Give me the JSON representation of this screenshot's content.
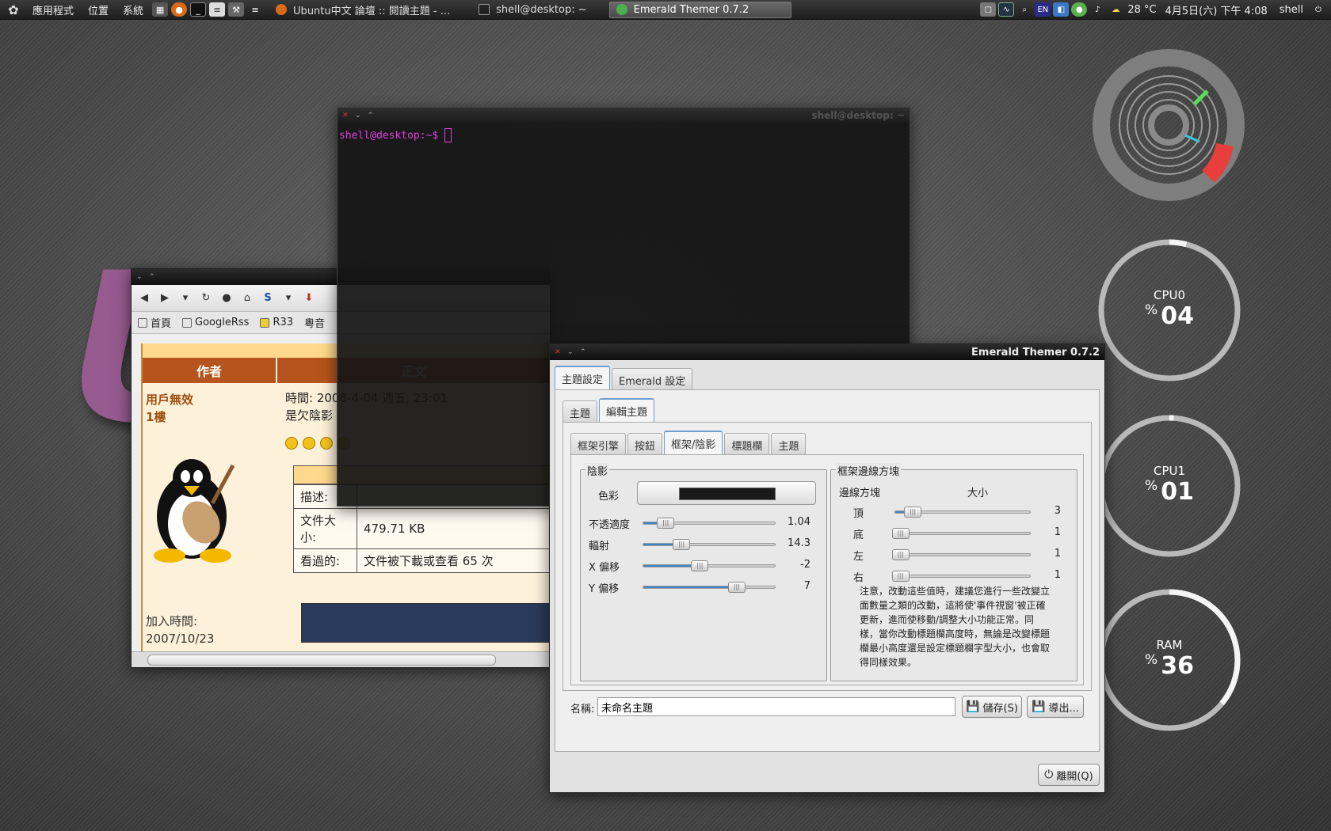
{
  "top_panel": {
    "menus": [
      "應用程式",
      "位置",
      "系統"
    ],
    "tasks": [
      {
        "label": "Ubuntu中文 論壇 :: 閱讀主題 - ...",
        "icon": "firefox-icon"
      },
      {
        "label": "shell@desktop: ~",
        "icon": "terminal-icon"
      },
      {
        "label": "Emerald Themer 0.7.2",
        "icon": "emerald-icon"
      }
    ],
    "input_method": "EN",
    "temperature": "28 °C",
    "datetime": "4月5日(六) 下午 4:08",
    "user": "shell"
  },
  "conky": {
    "cpu0": {
      "name": "CPU0",
      "pct_symbol": "%",
      "value": "04",
      "level": 0.04
    },
    "cpu1": {
      "name": "CPU1",
      "pct_symbol": "%",
      "value": "01",
      "level": 0.01
    },
    "ram": {
      "name": "RAM",
      "pct_symbol": "%",
      "value": "36",
      "level": 0.36
    }
  },
  "terminal": {
    "title": "shell@desktop: ~",
    "prompt": "shell@desktop:~$"
  },
  "browser": {
    "bookmarks": [
      "首頁",
      "GoogleRss",
      "R33",
      "粵音"
    ],
    "header_author": "作者",
    "header_body": "正文",
    "poster_name": "用戶無效",
    "floor": "1樓",
    "post_time": "時間: 2008-4-04 週五, 23:01",
    "post_text": "是欠陰影",
    "join_label": "加入時間:",
    "join_date": "2007/10/23",
    "attachment": {
      "desc_label": "描述:",
      "desc_value": "",
      "size_label": "文件大小:",
      "size_value": "479.71 KB",
      "views_label": "看過的:",
      "views_value": "文件被下載或查看 65 次"
    }
  },
  "emerald": {
    "title": "Emerald Themer 0.7.2",
    "top_tabs": [
      "主題設定",
      "Emerald 設定"
    ],
    "sub_tabs": [
      "主題",
      "編輯主題"
    ],
    "edit_tabs": [
      "框架引擎",
      "按鈕",
      "框架/陰影",
      "標題欄",
      "主題"
    ],
    "shadow": {
      "title": "陰影",
      "color_label": "色彩",
      "color_value": "#1a1a1a",
      "rows": [
        {
          "label": "不透適度",
          "value": "1.04",
          "level": 0.17
        },
        {
          "label": "輻射",
          "value": "14.3",
          "level": 0.29
        },
        {
          "label": "X 偏移",
          "value": "-2",
          "level": 0.43
        },
        {
          "label": "Y 偏移",
          "value": "7",
          "level": 0.71
        }
      ]
    },
    "border": {
      "title": "框架邊線方塊",
      "col_side": "邊線方塊",
      "col_size": "大小",
      "rows": [
        {
          "label": "頂",
          "value": "3",
          "level": 0.13
        },
        {
          "label": "底",
          "value": "1",
          "level": 0.04
        },
        {
          "label": "左",
          "value": "1",
          "level": 0.04
        },
        {
          "label": "右",
          "value": "1",
          "level": 0.04
        }
      ],
      "note": "注意，改動這些值時，建議您進行一些改變立面數量之類的改動，這將使'事件視窗'被正確更新，進而使移動/調整大小功能正常。同樣，當你改動標題欄高度時，無論是改變標題欄最小高度還是設定標題欄字型大小，也會取得同樣效果。"
    },
    "name_label": "名稱:",
    "name_value": "未命名主題",
    "save_label": "儲存(S)",
    "export_label": "導出...",
    "quit_label": "離開(Q)"
  }
}
